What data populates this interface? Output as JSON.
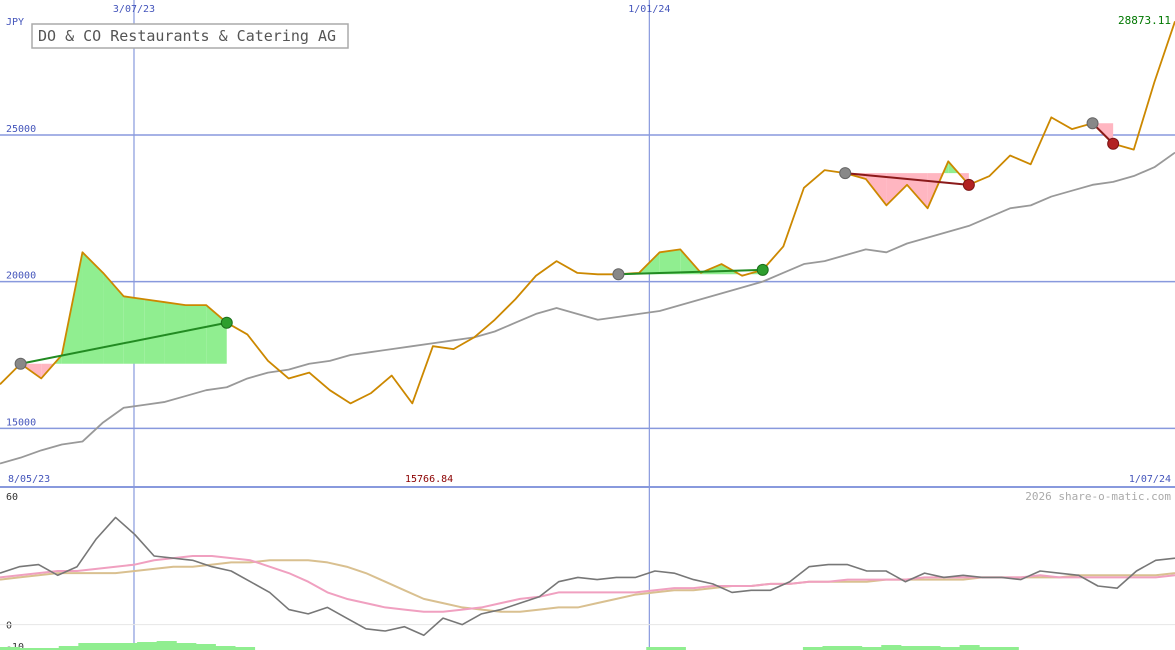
{
  "chart_data": [
    {
      "type": "line",
      "title": "DO & CO Restaurants & Catering AG",
      "currency_label": "JPY",
      "last_value_label": "28873.11",
      "xlabel_bottom_left": "8/05/23",
      "xlabel_bottom_right": "1/07/24",
      "min_marker_label": "15766.84",
      "top_date_labels": [
        {
          "label": "3/07/23",
          "index": 6.5
        },
        {
          "label": "1/01/24",
          "index": 31.5
        }
      ],
      "ylim": [
        13000,
        29600
      ],
      "y_ticks": [
        {
          "value": 25000,
          "label": "25000"
        },
        {
          "value": 20000,
          "label": "20000"
        },
        {
          "value": 15000,
          "label": "15000"
        }
      ],
      "colors": {
        "price": "#cc8800",
        "average": "#999999",
        "gain_fill": "#90ee90",
        "loss_fill": "#ffb6c1",
        "grid": "#8899dd",
        "axis_text": "#4455bb",
        "min_label": "#8b0000",
        "last_value": "#007700",
        "win_line": "#228b22",
        "loss_line": "#8b1a1a"
      },
      "series": [
        {
          "role": "price",
          "values": [
            16500,
            17200,
            16700,
            17500,
            21000,
            20300,
            19500,
            19400,
            19300,
            19200,
            19200,
            18600,
            18200,
            17300,
            16700,
            16900,
            16300,
            15850,
            16200,
            16800,
            15850,
            17800,
            17700,
            18100,
            18700,
            19400,
            20200,
            20700,
            20300,
            20250,
            20250,
            20300,
            21000,
            21100,
            20300,
            20600,
            20200,
            20400,
            21200,
            23200,
            23800,
            23700,
            23500,
            22600,
            23300,
            22500,
            24100,
            23300,
            23600,
            24300,
            24000,
            25600,
            25200,
            25400,
            24700,
            24500,
            26800,
            28873.11
          ]
        },
        {
          "role": "average",
          "values": [
            13800,
            14000,
            14250,
            14450,
            14550,
            15200,
            15700,
            15800,
            15900,
            16100,
            16300,
            16400,
            16700,
            16900,
            17000,
            17200,
            17300,
            17500,
            17600,
            17700,
            17800,
            17900,
            18000,
            18100,
            18300,
            18600,
            18900,
            19100,
            18900,
            18700,
            18800,
            18900,
            19000,
            19200,
            19400,
            19600,
            19800,
            20000,
            20300,
            20600,
            20700,
            20900,
            21100,
            21000,
            21300,
            21500,
            21700,
            21900,
            22200,
            22500,
            22600,
            22900,
            23100,
            23300,
            23400,
            23600,
            23900,
            24400
          ]
        }
      ],
      "trades": [
        {
          "entry_index": 1,
          "exit_index": 11,
          "result": "win"
        },
        {
          "entry_index": 30,
          "exit_index": 37,
          "result": "win"
        },
        {
          "entry_index": 41,
          "exit_index": 47,
          "result": "loss"
        },
        {
          "entry_index": 53,
          "exit_index": 54,
          "result": "loss"
        }
      ],
      "footer_text": "2026 share-o-matic.com"
    },
    {
      "type": "line",
      "ylim": [
        -10,
        60
      ],
      "y_ticks": [
        {
          "value": 60,
          "label": "60"
        },
        {
          "value": 0,
          "label": "0"
        },
        {
          "value": -10,
          "label": "-10"
        }
      ],
      "series": [
        {
          "role": "oscillator",
          "color": "#777777",
          "values": [
            24,
            27,
            28,
            23,
            27,
            40,
            50,
            42,
            32,
            31,
            30,
            27,
            25,
            20,
            15,
            7,
            5,
            8,
            3,
            -2,
            -3,
            -1,
            -5,
            3,
            0,
            5,
            7,
            10,
            13,
            20,
            22,
            21,
            22,
            22,
            25,
            24,
            21,
            19,
            15,
            16,
            16,
            20,
            27,
            28,
            28,
            25,
            25,
            20,
            24,
            22,
            23,
            22,
            22,
            21,
            25,
            24,
            23,
            18,
            17,
            25,
            30,
            31
          ]
        },
        {
          "role": "signal-pink",
          "color": "#f0a0c0",
          "values": [
            22,
            23,
            24,
            25,
            25,
            26,
            27,
            28,
            30,
            31,
            32,
            32,
            31,
            30,
            27,
            24,
            20,
            15,
            12,
            10,
            8,
            7,
            6,
            6,
            7,
            8,
            10,
            12,
            13,
            15,
            15,
            15,
            15,
            15,
            16,
            17,
            17,
            18,
            18,
            18,
            19,
            19,
            20,
            20,
            21,
            21,
            21,
            21,
            22,
            22,
            22,
            22,
            22,
            22,
            23,
            22,
            22,
            22,
            22,
            22,
            22,
            23
          ]
        },
        {
          "role": "signal-tan",
          "color": "#d9c090",
          "values": [
            21,
            22,
            23,
            24,
            24,
            24,
            24,
            25,
            26,
            27,
            27,
            28,
            29,
            29,
            30,
            30,
            30,
            29,
            27,
            24,
            20,
            16,
            12,
            10,
            8,
            7,
            6,
            6,
            7,
            8,
            8,
            10,
            12,
            14,
            15,
            16,
            16,
            17,
            18,
            18,
            19,
            19,
            20,
            20,
            20,
            20,
            21,
            21,
            21,
            21,
            21,
            22,
            22,
            22,
            22,
            22,
            23,
            23,
            23,
            23,
            23,
            24
          ]
        }
      ],
      "volume_bars": [
        3,
        2,
        2,
        4,
        7,
        7,
        7,
        8,
        9,
        7,
        6,
        4,
        3,
        0,
        0,
        0,
        0,
        0,
        0,
        0,
        0,
        0,
        0,
        0,
        0,
        0,
        0,
        0,
        0,
        0,
        0,
        0,
        0,
        3,
        3,
        0,
        0,
        0,
        0,
        0,
        0,
        3,
        4,
        4,
        3,
        5,
        4,
        4,
        3,
        5,
        3,
        3,
        0,
        0,
        0,
        0,
        0,
        0,
        0,
        0
      ]
    }
  ]
}
